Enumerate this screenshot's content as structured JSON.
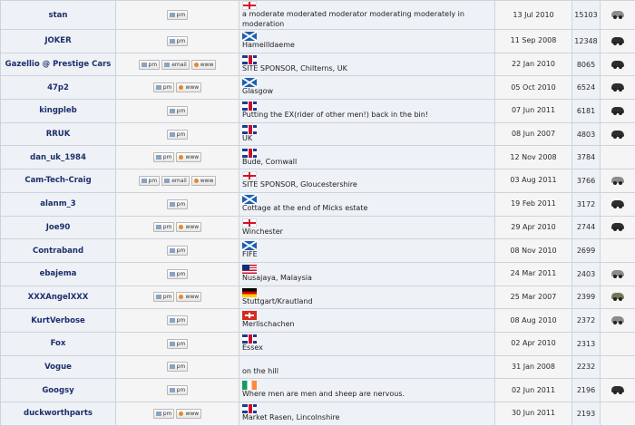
{
  "buttons": {
    "pm": "pm",
    "email": "email",
    "www": "www"
  },
  "rows": [
    {
      "username": "stan",
      "contacts": [
        "pm"
      ],
      "flag": "flag-eng",
      "location": "a moderate moderated moderator moderating moderately in moderation",
      "joined": "13 Jul 2010",
      "posts": "15103",
      "car": "car"
    },
    {
      "username": "JOKER",
      "contacts": [
        "pm"
      ],
      "flag": "flag-sco",
      "location": "Hameilldaeme",
      "joined": "11 Sep 2008",
      "posts": "12348",
      "car": "car-dark"
    },
    {
      "username": "Gazellio @ Prestige Cars",
      "contacts": [
        "pm",
        "email",
        "www"
      ],
      "flag": "flag-uk",
      "location": "SITE SPONSOR, Chilterns, UK",
      "joined": "22 Jan 2010",
      "posts": "8065",
      "car": "car-dark"
    },
    {
      "username": "47p2",
      "contacts": [
        "pm",
        "www"
      ],
      "flag": "flag-sco",
      "location": "Glasgow",
      "joined": "05 Oct 2010",
      "posts": "6524",
      "car": "car-dark"
    },
    {
      "username": "kingpleb",
      "contacts": [
        "pm"
      ],
      "flag": "flag-uk",
      "location": "Putting the EX(rider of other men!) back in the bin!",
      "joined": "07 Jun 2011",
      "posts": "6181",
      "car": "car-dark"
    },
    {
      "username": "RRUK",
      "contacts": [
        "pm"
      ],
      "flag": "flag-uk",
      "location": "UK",
      "joined": "08 Jun 2007",
      "posts": "4803",
      "car": "car-dark"
    },
    {
      "username": "dan_uk_1984",
      "contacts": [
        "pm",
        "www"
      ],
      "flag": "flag-uk",
      "location": "Bude, Cornwall",
      "joined": "12 Nov 2008",
      "posts": "3784",
      "car": ""
    },
    {
      "username": "Cam-Tech-Craig",
      "contacts": [
        "pm",
        "email",
        "www"
      ],
      "flag": "flag-eng",
      "location": "SITE SPONSOR, Gloucestershire",
      "joined": "03 Aug 2011",
      "posts": "3766",
      "car": "car"
    },
    {
      "username": "alanm_3",
      "contacts": [
        "pm"
      ],
      "flag": "flag-sco",
      "location": "Cottage at the end of Micks estate",
      "joined": "19 Feb 2011",
      "posts": "3172",
      "car": "car-dark"
    },
    {
      "username": "Joe90",
      "contacts": [
        "pm",
        "www"
      ],
      "flag": "flag-eng",
      "location": "Winchester",
      "joined": "29 Apr 2010",
      "posts": "2744",
      "car": "car-dark"
    },
    {
      "username": "Contraband",
      "contacts": [
        "pm"
      ],
      "flag": "flag-sco",
      "location": "FIFE",
      "joined": "08 Nov 2010",
      "posts": "2699",
      "car": ""
    },
    {
      "username": "ebajema",
      "contacts": [
        "pm"
      ],
      "flag": "flag-my",
      "location": "Nusajaya, Malaysia",
      "joined": "24 Mar 2011",
      "posts": "2403",
      "car": "car"
    },
    {
      "username": "XXXAngelXXX",
      "contacts": [
        "pm",
        "www"
      ],
      "flag": "flag-de",
      "location": "Stuttgart/Krautland",
      "joined": "25 Mar 2007",
      "posts": "2399",
      "car": "car-green"
    },
    {
      "username": "KurtVerbose",
      "contacts": [
        "pm"
      ],
      "flag": "flag-ch",
      "location": "Merlischachen",
      "joined": "08 Aug 2010",
      "posts": "2372",
      "car": "car"
    },
    {
      "username": "Fox",
      "contacts": [
        "pm"
      ],
      "flag": "flag-uk",
      "location": "Essex",
      "joined": "02 Apr 2010",
      "posts": "2313",
      "car": ""
    },
    {
      "username": "Vogue",
      "contacts": [
        "pm"
      ],
      "flag": "",
      "location": "on the hill",
      "joined": "31 Jan 2008",
      "posts": "2232",
      "car": ""
    },
    {
      "username": "Googsy",
      "contacts": [
        "pm"
      ],
      "flag": "flag-ie",
      "location": "Where men are men and sheep are nervous.",
      "joined": "02 Jun 2011",
      "posts": "2196",
      "car": "car-dark"
    },
    {
      "username": "duckworthparts",
      "contacts": [
        "pm",
        "www"
      ],
      "flag": "flag-uk",
      "location": "Market Rasen, Lincolnshire",
      "joined": "30 Jun 2011",
      "posts": "2193",
      "car": ""
    }
  ]
}
